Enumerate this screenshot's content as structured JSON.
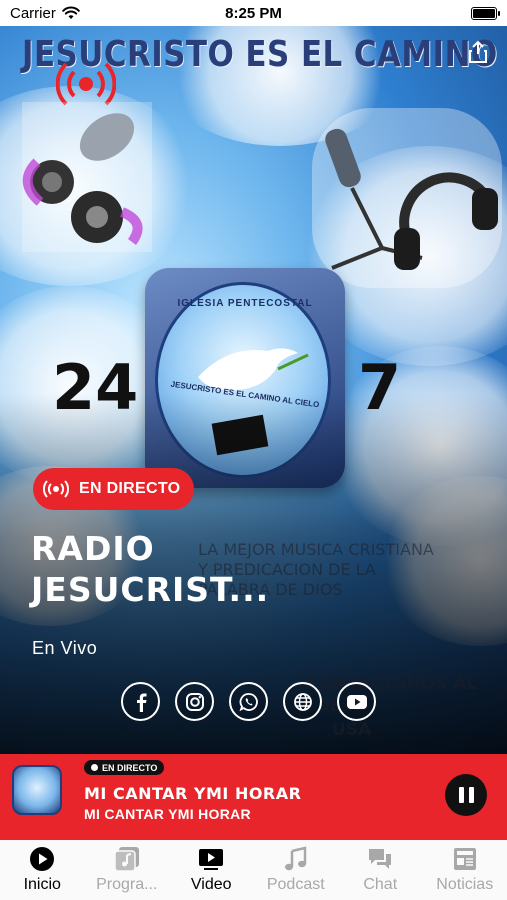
{
  "status_bar": {
    "carrier": "Carrier",
    "time": "8:25 PM"
  },
  "hero": {
    "banner_title": "JESUCRISTO ES EL CAMINO",
    "badge_top_text": "IGLESIA PENTECOSTAL",
    "badge_mid_text": "JESUCRISTO ES EL CAMINO AL CIELO",
    "left_number": "24",
    "right_number": "7",
    "faded_tagline": "LA MEJOR MUSICA CRISTIANA Y PREDICACION DE LA PALABRA DE DIOS",
    "faded_contact": "CONTACTANOS AL",
    "faded_phone": "0836",
    "faded_country": "USA"
  },
  "live": {
    "label": "EN DIRECTO"
  },
  "station": {
    "name": "RADIO JESUCRIST...",
    "subtitle": "En Vivo"
  },
  "socials": [
    {
      "icon": "facebook-icon"
    },
    {
      "icon": "instagram-icon"
    },
    {
      "icon": "whatsapp-icon"
    },
    {
      "icon": "globe-icon"
    },
    {
      "icon": "youtube-icon"
    }
  ],
  "mini_player": {
    "badge": "EN DIRECTO",
    "title": "MI CANTAR YMI HORAR",
    "subtitle": "MI CANTAR YMI HORAR"
  },
  "tabs": [
    {
      "label": "Inicio",
      "icon": "play-circle-icon",
      "active": true
    },
    {
      "label": "Progra...",
      "icon": "music-note-square-icon",
      "active": false
    },
    {
      "label": "Video",
      "icon": "video-play-icon",
      "active": true
    },
    {
      "label": "Podcast",
      "icon": "music-note-icon",
      "active": false
    },
    {
      "label": "Chat",
      "icon": "chat-bubbles-icon",
      "active": false
    },
    {
      "label": "Noticias",
      "icon": "newspaper-icon",
      "active": false
    }
  ],
  "colors": {
    "accent_red": "#e8252b",
    "tab_inactive": "#a8a8a8",
    "tab_active": "#000000"
  }
}
